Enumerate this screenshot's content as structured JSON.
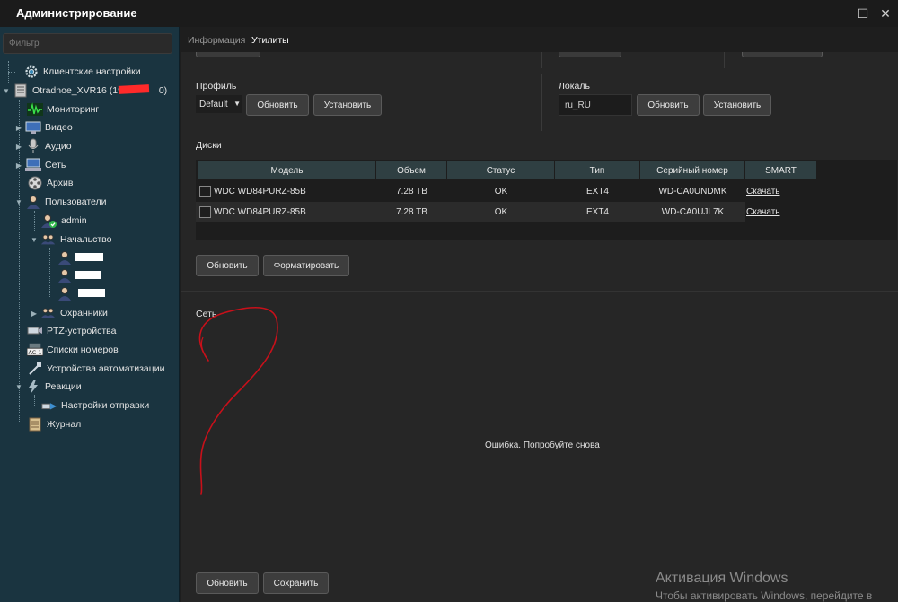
{
  "window": {
    "title": "Администрирование",
    "maximize_glyph": "☐",
    "close_glyph": "✕"
  },
  "sidebar": {
    "filter_placeholder": "Фильтр",
    "items": [
      {
        "label": "Клиентские настройки",
        "icon": "settings-gear-icon"
      },
      {
        "label": "Otradnoe_XVR16 (192",
        "suffix": "0)",
        "icon": "server-icon"
      },
      {
        "label": "Мониторинг",
        "icon": "monitoring-icon"
      },
      {
        "label": "Видео",
        "icon": "video-icon"
      },
      {
        "label": "Аудио",
        "icon": "microphone-icon"
      },
      {
        "label": "Сеть",
        "icon": "network-icon"
      },
      {
        "label": "Архив",
        "icon": "film-reel-icon"
      },
      {
        "label": "Пользователи",
        "icon": "user-icon"
      },
      {
        "label": "admin",
        "icon": "admin-user-icon"
      },
      {
        "label": "Начальство",
        "icon": "user-group-icon"
      },
      {
        "label": "",
        "icon": "user-icon"
      },
      {
        "label": "",
        "icon": "user-icon"
      },
      {
        "label": "",
        "icon": "user-icon"
      },
      {
        "label": "Охранники",
        "icon": "user-group-icon"
      },
      {
        "label": "PTZ-устройства",
        "icon": "ptz-camera-icon"
      },
      {
        "label": "Списки номеров",
        "icon": "license-plate-icon"
      },
      {
        "label": "Устройства автоматизации",
        "icon": "automation-icon"
      },
      {
        "label": "Реакции",
        "icon": "lightning-icon"
      },
      {
        "label": "Настройки отправки",
        "icon": "send-settings-icon"
      },
      {
        "label": "Журнал",
        "icon": "journal-icon"
      }
    ]
  },
  "tabs": [
    {
      "label": "Информация",
      "active": false
    },
    {
      "label": "Утилиты",
      "active": true
    }
  ],
  "profile": {
    "label": "Профиль",
    "selected": "Default",
    "refresh_button": "Обновить",
    "apply_button": "Установить"
  },
  "locale": {
    "label": "Локаль",
    "value": "ru_RU",
    "refresh_button": "Обновить",
    "apply_button": "Установить"
  },
  "disks": {
    "label": "Диски",
    "columns": [
      "Модель",
      "Объем",
      "Статус",
      "Тип",
      "Серийный номер",
      "SMART"
    ],
    "rows": [
      {
        "model": "WDC WD84PURZ-85B",
        "size": "7.28 TB",
        "status": "OK",
        "type": "EXT4",
        "serial": "WD-CA0UNDMK",
        "smart": "Скачать"
      },
      {
        "model": "WDC WD84PURZ-85B",
        "size": "7.28 TB",
        "status": "OK",
        "type": "EXT4",
        "serial": "WD-CA0UJL7K",
        "smart": "Скачать"
      }
    ],
    "refresh_button": "Обновить",
    "format_button": "Форматировать"
  },
  "network": {
    "label": "Сеть",
    "error": "Ошибка. Попробуйте снова",
    "refresh_button": "Обновить",
    "save_button": "Сохранить"
  },
  "watermark": {
    "title": "Активация Windows",
    "subtitle": "Чтобы активировать Windows, перейдите в"
  },
  "colors": {
    "sidebar_bg": "#1a3440",
    "content_bg": "#262626",
    "header_bg": "#2f3f42",
    "annotation_red": "#c8101a"
  }
}
